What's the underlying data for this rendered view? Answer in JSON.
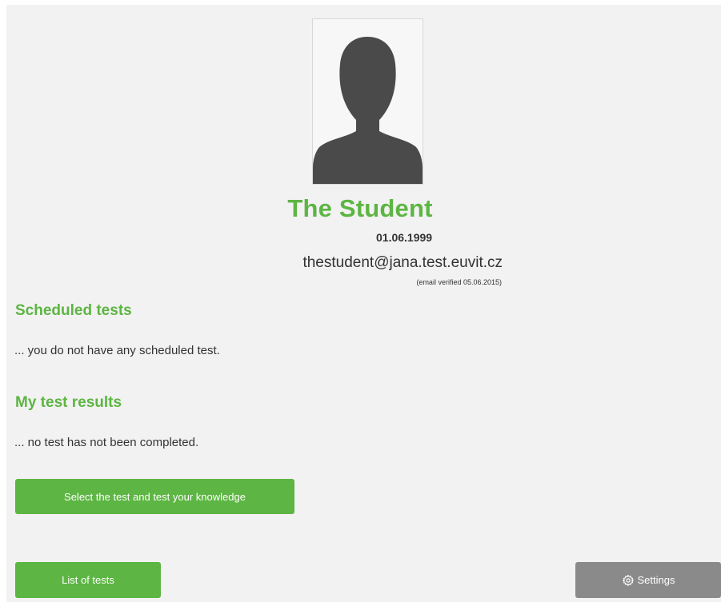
{
  "profile": {
    "name": "The Student",
    "birth_date": "01.06.1999",
    "email": "thestudent@jana.test.euvit.cz",
    "email_verified": "(email verified 05.06.2015)"
  },
  "scheduled": {
    "title": "Scheduled tests",
    "empty_text": "... you do not have any scheduled test."
  },
  "results": {
    "title": "My test results",
    "empty_text": "... no test has not been completed."
  },
  "buttons": {
    "select_test": "Select the test and test your knowledge",
    "list_of_tests": "List of tests",
    "settings": "Settings"
  },
  "icons": {
    "avatar": "person-silhouette-icon",
    "settings": "gear-icon"
  },
  "colors": {
    "accent_green": "#5db543",
    "settings_grey": "#8a8a8a",
    "panel_bg": "#f2f2f2",
    "silhouette": "#4a4a4a"
  }
}
